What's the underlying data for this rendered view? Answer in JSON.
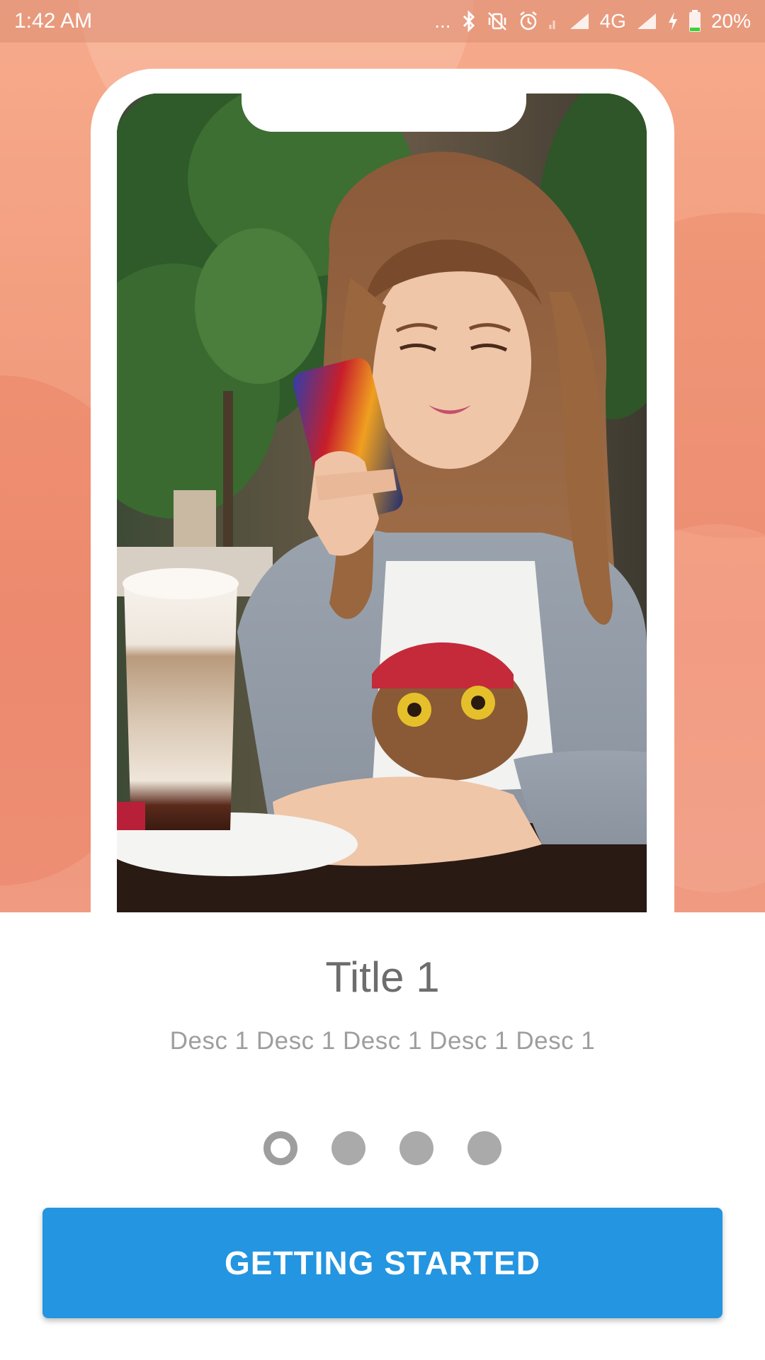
{
  "status_bar": {
    "time": "1:42 AM",
    "dots": "...",
    "network": "4G",
    "battery": "20%",
    "icons": [
      "bluetooth-icon",
      "vibrate-off-icon",
      "alarm-icon",
      "signal-icon",
      "signal-icon",
      "charging-icon",
      "battery-icon"
    ]
  },
  "onboarding": {
    "image_icon": "photo-woman-phone",
    "title": "Title 1",
    "description": "Desc 1 Desc 1 Desc 1 Desc 1 Desc 1",
    "page_count": 4,
    "current_page": 1,
    "button_label": "GETTING STARTED"
  },
  "colors": {
    "hero_background": "#f29e7f",
    "button": "#2495e0",
    "title_text": "#6d6d6d",
    "desc_text": "#9e9e9e",
    "dot_inactive": "#aaaaaa"
  }
}
